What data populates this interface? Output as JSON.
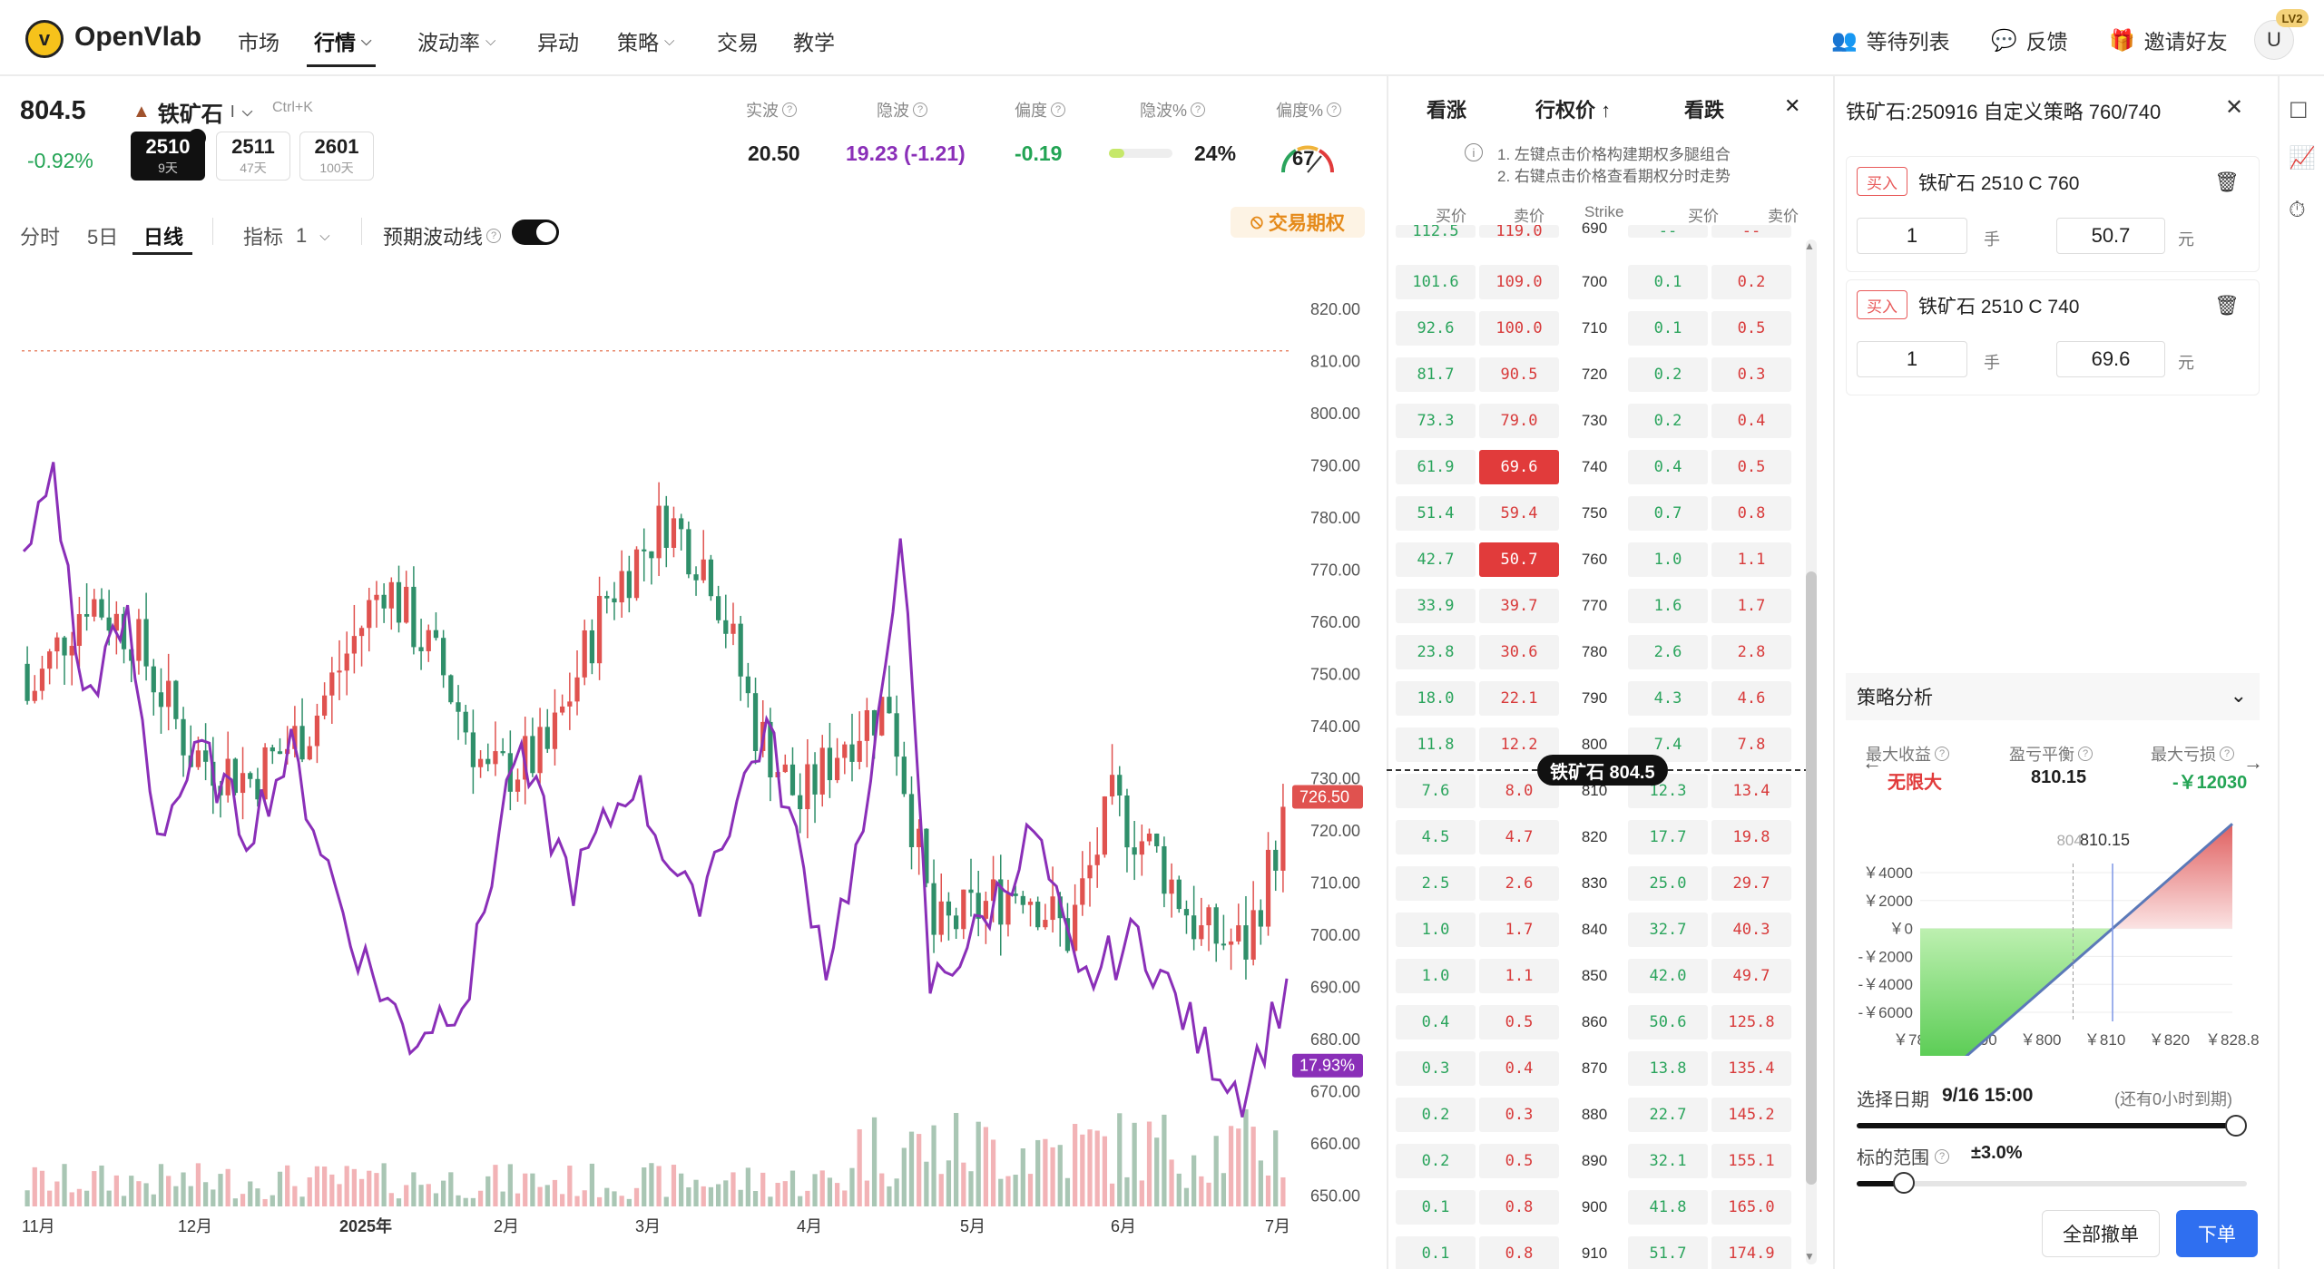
{
  "app": {
    "brand": "OpenVlab",
    "logo_letter": "v"
  },
  "nav": {
    "items": [
      {
        "label": "市场",
        "chev": false
      },
      {
        "label": "行情",
        "chev": true,
        "active": true
      },
      {
        "label": "波动率",
        "chev": true
      },
      {
        "label": "异动",
        "chev": false
      },
      {
        "label": "策略",
        "chev": true
      },
      {
        "label": "交易",
        "chev": false
      },
      {
        "label": "教学",
        "chev": false
      }
    ],
    "watchlist": "等待列表",
    "feedback": "反馈",
    "invite": "邀请好友",
    "avatar": "U",
    "level": "LV2"
  },
  "header": {
    "price": "804.5",
    "change": "-0.92%",
    "name": "铁矿石",
    "name_suffix": "I",
    "shortcut": "Ctrl+K",
    "contracts": [
      {
        "code": "2510",
        "days": "9天",
        "active": true,
        "badge": "主"
      },
      {
        "code": "2511",
        "days": "47天"
      },
      {
        "code": "2601",
        "days": "100天"
      }
    ],
    "stats": [
      {
        "label": "实波",
        "value": "20.50",
        "color": "#1f1f1f"
      },
      {
        "label": "隐波",
        "value": "19.23 (-1.21)",
        "color": "#8a2fb8"
      },
      {
        "label": "偏度",
        "value": "-0.19",
        "color": "#23a454"
      },
      {
        "label": "隐波%",
        "value": "24%",
        "color": "#1f1f1f"
      },
      {
        "label": "偏度%",
        "value": "67",
        "color": "#1f1f1f"
      }
    ],
    "iv_pct_fill": 0.24
  },
  "toolbar": {
    "tabs": [
      "分时",
      "5日",
      "日线"
    ],
    "active_tab": "日线",
    "indicator": "指标",
    "indicator_count": "1",
    "expected_vol": "预期波动线",
    "trade_options": "交易期权"
  },
  "chart_data": {
    "type": "candlestick",
    "y_ticks": [
      "820.00",
      "810.00",
      "800.00",
      "790.00",
      "780.00",
      "770.00",
      "760.00",
      "750.00",
      "740.00",
      "730.00",
      "720.00",
      "710.00",
      "700.00",
      "690.00",
      "680.00",
      "670.00",
      "660.00",
      "650.00"
    ],
    "x_ticks": [
      "11月",
      "12月",
      "2025年",
      "2月",
      "3月",
      "4月",
      "5月",
      "6月",
      "7月"
    ],
    "ylim": [
      648,
      825
    ],
    "last_price_label": "726.50",
    "iv_label": "17.93%",
    "reference_line": 812,
    "candles_summary": "daily candles with volume and implied volatility overlay",
    "colors": {
      "up": "#e0524f",
      "down": "#2f8f6a",
      "iv": "#8a2fb8",
      "vol_up": "#f2b3b6",
      "vol_down": "#a9c6b4"
    }
  },
  "chain": {
    "call_label": "看涨",
    "strike_label": "行权价",
    "put_label": "看跌",
    "tips": [
      "1. 左键点击价格构建期权多腿组合",
      "2. 右键点击价格查看期权分时走势"
    ],
    "cols": [
      "买价",
      "卖价",
      "Strike",
      "买价",
      "卖价"
    ],
    "rows": [
      {
        "s": "690",
        "cb": "112.5",
        "ca": "119.0",
        "pb": "--",
        "pa": "--"
      },
      {
        "s": "700",
        "cb": "101.6",
        "ca": "109.0",
        "pb": "0.1",
        "pa": "0.2"
      },
      {
        "s": "710",
        "cb": "92.6",
        "ca": "100.0",
        "pb": "0.1",
        "pa": "0.5"
      },
      {
        "s": "720",
        "cb": "81.7",
        "ca": "90.5",
        "pb": "0.2",
        "pa": "0.3"
      },
      {
        "s": "730",
        "cb": "73.3",
        "ca": "79.0",
        "pb": "0.2",
        "pa": "0.4"
      },
      {
        "s": "740",
        "cb": "61.9",
        "ca": "69.6",
        "pb": "0.4",
        "pa": "0.5",
        "sel": true
      },
      {
        "s": "750",
        "cb": "51.4",
        "ca": "59.4",
        "pb": "0.7",
        "pa": "0.8"
      },
      {
        "s": "760",
        "cb": "42.7",
        "ca": "50.7",
        "pb": "1.0",
        "pa": "1.1",
        "sel": true
      },
      {
        "s": "770",
        "cb": "33.9",
        "ca": "39.7",
        "pb": "1.6",
        "pa": "1.7"
      },
      {
        "s": "780",
        "cb": "23.8",
        "ca": "30.6",
        "pb": "2.6",
        "pa": "2.8"
      },
      {
        "s": "790",
        "cb": "18.0",
        "ca": "22.1",
        "pb": "4.3",
        "pa": "4.6"
      },
      {
        "s": "800",
        "cb": "11.8",
        "ca": "12.2",
        "pb": "7.4",
        "pa": "7.8"
      },
      {
        "s": "810",
        "cb": "7.6",
        "ca": "8.0",
        "pb": "12.3",
        "pa": "13.4"
      },
      {
        "s": "820",
        "cb": "4.5",
        "ca": "4.7",
        "pb": "17.7",
        "pa": "19.8"
      },
      {
        "s": "830",
        "cb": "2.5",
        "ca": "2.6",
        "pb": "25.0",
        "pa": "29.7"
      },
      {
        "s": "840",
        "cb": "1.0",
        "ca": "1.7",
        "pb": "32.7",
        "pa": "40.3"
      },
      {
        "s": "850",
        "cb": "1.0",
        "ca": "1.1",
        "pb": "42.0",
        "pa": "49.7"
      },
      {
        "s": "860",
        "cb": "0.4",
        "ca": "0.5",
        "pb": "50.6",
        "pa": "125.8"
      },
      {
        "s": "870",
        "cb": "0.3",
        "ca": "0.4",
        "pb": "13.8",
        "pa": "135.4"
      },
      {
        "s": "880",
        "cb": "0.2",
        "ca": "0.3",
        "pb": "22.7",
        "pa": "145.2"
      },
      {
        "s": "890",
        "cb": "0.2",
        "ca": "0.5",
        "pb": "32.1",
        "pa": "155.1"
      },
      {
        "s": "900",
        "cb": "0.1",
        "ca": "0.8",
        "pb": "41.8",
        "pa": "165.0"
      },
      {
        "s": "910",
        "cb": "0.1",
        "ca": "0.8",
        "pb": "51.7",
        "pa": "174.9"
      }
    ],
    "spot_label": "铁矿石 804.5"
  },
  "panel": {
    "title": "铁矿石:250916 自定义策略 760/740",
    "legs": [
      {
        "tag": "买入",
        "name": "铁矿石 2510 C 760",
        "qty": "1",
        "qty_unit": "手",
        "price": "50.7",
        "price_unit": "元"
      },
      {
        "tag": "买入",
        "name": "铁矿石 2510 C 740",
        "qty": "1",
        "qty_unit": "手",
        "price": "69.6",
        "price_unit": "元"
      }
    ],
    "analysis_title": "策略分析",
    "metrics": [
      {
        "label": "最大收益",
        "value": "无限大",
        "color": "#e13b3b"
      },
      {
        "label": "盈亏平衡",
        "value": "810.15",
        "color": "#1f1f1f"
      },
      {
        "label": "最大亏损",
        "value": "-￥12030",
        "color": "#23a454"
      }
    ],
    "payoff": {
      "marker_spot": "804",
      "marker_be": "810.15",
      "y_ticks": [
        "￥4000",
        "￥2000",
        "￥0",
        "-￥2000",
        "-￥4000",
        "-￥6000"
      ],
      "x_ticks": [
        "￥780.2",
        "￥790",
        "￥800",
        "￥810",
        "￥820",
        "￥828.8"
      ]
    },
    "date_label": "选择日期",
    "date_value": "9/16 15:00",
    "date_note": "(还有0小时到期)",
    "range_label": "标的范围",
    "range_value": "±3.0%",
    "cancel_all": "全部撤单",
    "place_order": "下单"
  }
}
